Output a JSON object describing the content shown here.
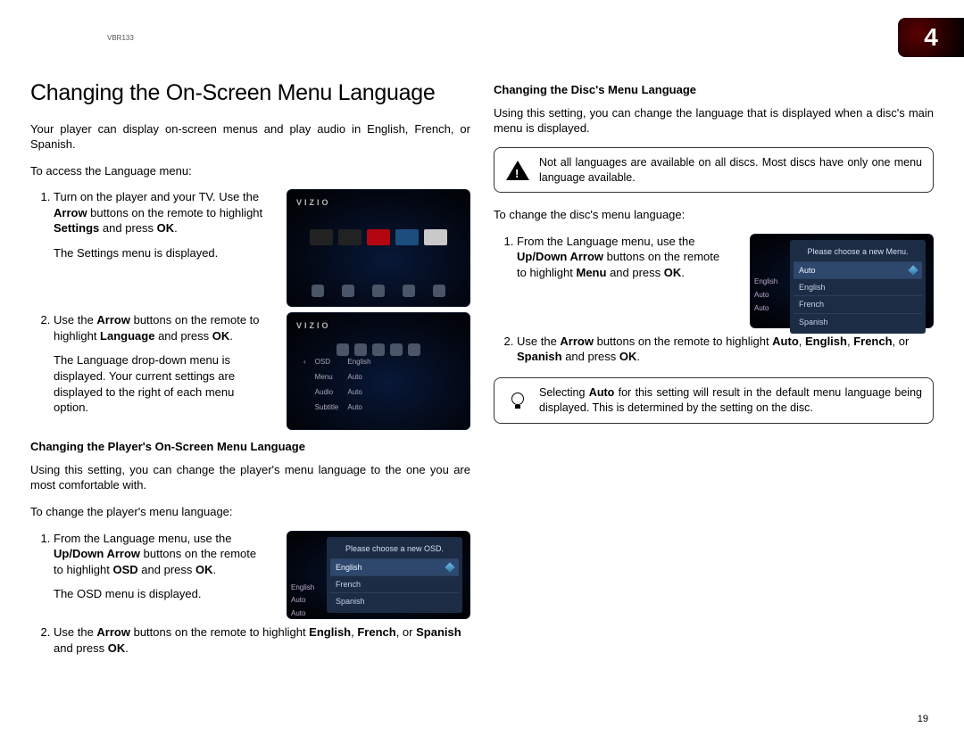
{
  "header": {
    "model": "VBR133",
    "chapter": "4"
  },
  "left": {
    "title": "Changing the On-Screen Menu Language",
    "intro": "Your player can display on-screen menus and play audio in English, French, or Spanish.",
    "access": "To access the Language menu:",
    "step1a": "Turn on the player and your TV. Use the ",
    "step1b": "Arrow",
    "step1c": " buttons on the remote to highlight ",
    "step1d": "Settings",
    "step1e": " and press ",
    "step1f": "OK",
    "step1g": ".",
    "step1result": "The Settings menu is displayed.",
    "step2a": "Use the ",
    "step2b": "Arrow",
    "step2c": " buttons on the remote to highlight ",
    "step2d": "Language",
    "step2e": " and press ",
    "step2f": "OK",
    "step2g": ".",
    "step2result": "The Language drop-down menu is displayed. Your current settings are displayed to the right of each menu option.",
    "subheading": "Changing the Player's On-Screen Menu Language",
    "subintro": "Using this setting, you can change the player's menu language to the one you are most comfortable with.",
    "sublead": "To change the player's menu language:",
    "ostep1a": "From the Language menu, use the ",
    "ostep1b": "Up/Down Arrow",
    "ostep1c": " buttons on the remote to highlight ",
    "ostep1d": "OSD",
    "ostep1e": " and press ",
    "ostep1f": "OK",
    "ostep1g": ".",
    "ostep1result": "The OSD menu is displayed.",
    "ostep2a": "Use the ",
    "ostep2b": "Arrow",
    "ostep2c": " buttons on the remote to highlight ",
    "ostep2d": "English",
    "ostep2e": ", ",
    "ostep2f": "French",
    "ostep2g": ", or ",
    "ostep2h": "Spanish",
    "ostep2i": " and press ",
    "ostep2j": "OK",
    "ostep2k": ".",
    "osd_shot": {
      "title": "Please choose a new OSD.",
      "options": [
        "English",
        "French",
        "Spanish"
      ],
      "left_labels": [
        "English",
        "Auto",
        "Auto"
      ]
    },
    "shot_brand": "VIZIO"
  },
  "right": {
    "subheading": "Changing the Disc's Menu Language",
    "intro": "Using this setting, you can change the language that is displayed when a disc's main menu is displayed.",
    "warn": "Not all languages are available on all discs. Most discs have only one menu language available.",
    "lead": "To change the disc's menu language:",
    "d1a": "From the Language menu, use the ",
    "d1b": "Up/Down Arrow",
    "d1c": " buttons on the remote to highlight ",
    "d1d": "Menu",
    "d1e": " and press ",
    "d1f": "OK",
    "d1g": ".",
    "d2a": "Use the ",
    "d2b": "Arrow",
    "d2c": " buttons on the remote to highlight ",
    "d2d": "Auto",
    "d2e": ", ",
    "d2f": "English",
    "d2g": ", ",
    "d2h": "French",
    "d2i": ", or ",
    "d2j": "Spanish",
    "d2k": " and press ",
    "d2l": "OK",
    "d2m": ".",
    "menu_shot": {
      "title": "Please choose a new Menu.",
      "options": [
        "Auto",
        "English",
        "French",
        "Spanish"
      ],
      "left_labels": [
        "English",
        "Auto",
        "Auto"
      ]
    },
    "hint_a": "Selecting ",
    "hint_b": "Auto",
    "hint_c": " for this setting will result in the default menu language being displayed. This is determined by the setting on the disc."
  },
  "page_number": "19"
}
